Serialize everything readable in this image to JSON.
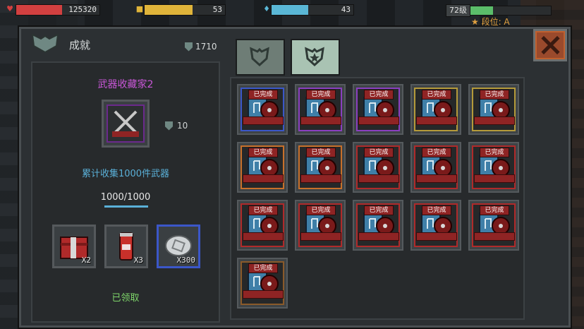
{
  "hud": {
    "health": {
      "icon": "heart-icon",
      "value": "125320",
      "fill_fraction": 0.55,
      "color": "#d24040"
    },
    "armor": {
      "icon": "armor-icon",
      "value": "53",
      "fill_fraction": 0.6,
      "color": "#e0b43a"
    },
    "energy": {
      "icon": "energy-drop-icon",
      "value": "43",
      "fill_fraction": 0.45,
      "color": "#5ab7d6"
    },
    "level": {
      "label": "72级",
      "fill_fraction": 0.28
    },
    "rank": {
      "icon": "star-icon",
      "label": "段位: A"
    }
  },
  "panel": {
    "title": "成就",
    "points": "1710",
    "tabs": [
      {
        "icon": "shield-achievement-icon"
      },
      {
        "icon": "shield-star-icon"
      }
    ]
  },
  "detail": {
    "name": "武器收藏家2",
    "points": "10",
    "description": "累计收集1000件武器",
    "progress": "1000/1000",
    "progress_fraction": 1.0,
    "rewards": [
      {
        "icon": "supply-crate-icon",
        "qty": "X2"
      },
      {
        "icon": "cola-can-icon",
        "qty": "X3"
      },
      {
        "icon": "silver-coin-icon",
        "qty": "X300"
      }
    ],
    "status": "已领取"
  },
  "grid": {
    "items": [
      {
        "label": "已完成",
        "border": "#3b57c9"
      },
      {
        "label": "已完成",
        "border": "#8a3fc0"
      },
      {
        "label": "已完成",
        "border": "#8a3fc0"
      },
      {
        "label": "已完成",
        "border": "#b59a3a"
      },
      {
        "label": "已完成",
        "border": "#b59a3a"
      },
      {
        "label": "已完成",
        "border": "#c8702a"
      },
      {
        "label": "已完成",
        "border": "#c8702a"
      },
      {
        "label": "已完成",
        "border": "#b02a2a"
      },
      {
        "label": "已完成",
        "border": "#b02a2a"
      },
      {
        "label": "已完成",
        "border": "#b02a2a"
      },
      {
        "label": "已完成",
        "border": "#b02a2a"
      },
      {
        "label": "已完成",
        "border": "#b02a2a"
      },
      {
        "label": "已完成",
        "border": "#b02a2a"
      },
      {
        "label": "已完成",
        "border": "#b02a2a"
      },
      {
        "label": "已完成",
        "border": "#b02a2a"
      },
      {
        "label": "已完成",
        "border": "#8a5a2a"
      }
    ]
  }
}
